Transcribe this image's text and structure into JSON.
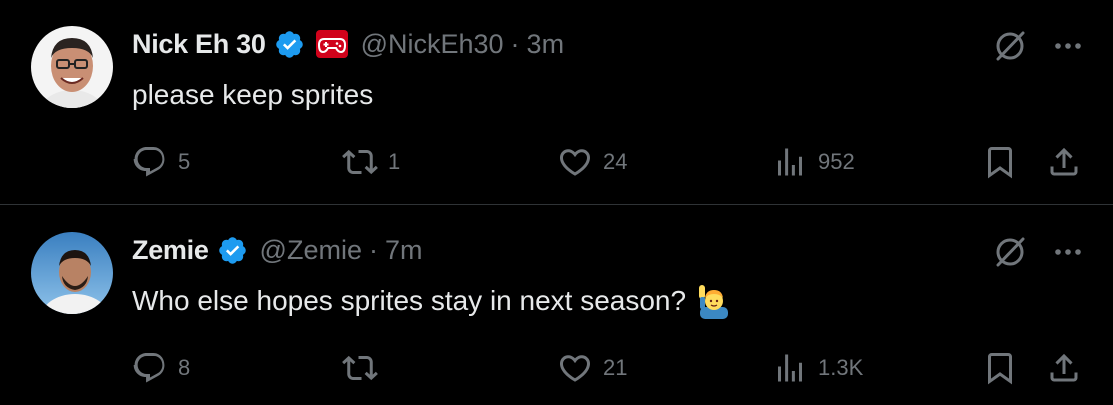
{
  "tweets": [
    {
      "name": "Nick Eh 30",
      "handle": "@NickEh30",
      "separator": "·",
      "time": "3m",
      "text": "please keep sprites",
      "reply_count": "5",
      "retweet_count": "1",
      "like_count": "24",
      "view_count": "952",
      "has_affiliate_badge": true,
      "affiliate_icon": "red-gamepad-badge-icon"
    },
    {
      "name": "Zemie",
      "handle": "@Zemie",
      "separator": "·",
      "time": "7m",
      "text": "Who else hopes sprites stay in next season?",
      "emoji_icon": "raising-hand-emoji",
      "reply_count": "8",
      "retweet_count": "",
      "like_count": "21",
      "view_count": "1.3K",
      "has_affiliate_badge": false
    }
  ],
  "colors": {
    "background": "#000000",
    "text": "#e7e9ea",
    "muted": "#71767b",
    "verified": "#1d9bf0",
    "divider": "#2f3336"
  }
}
